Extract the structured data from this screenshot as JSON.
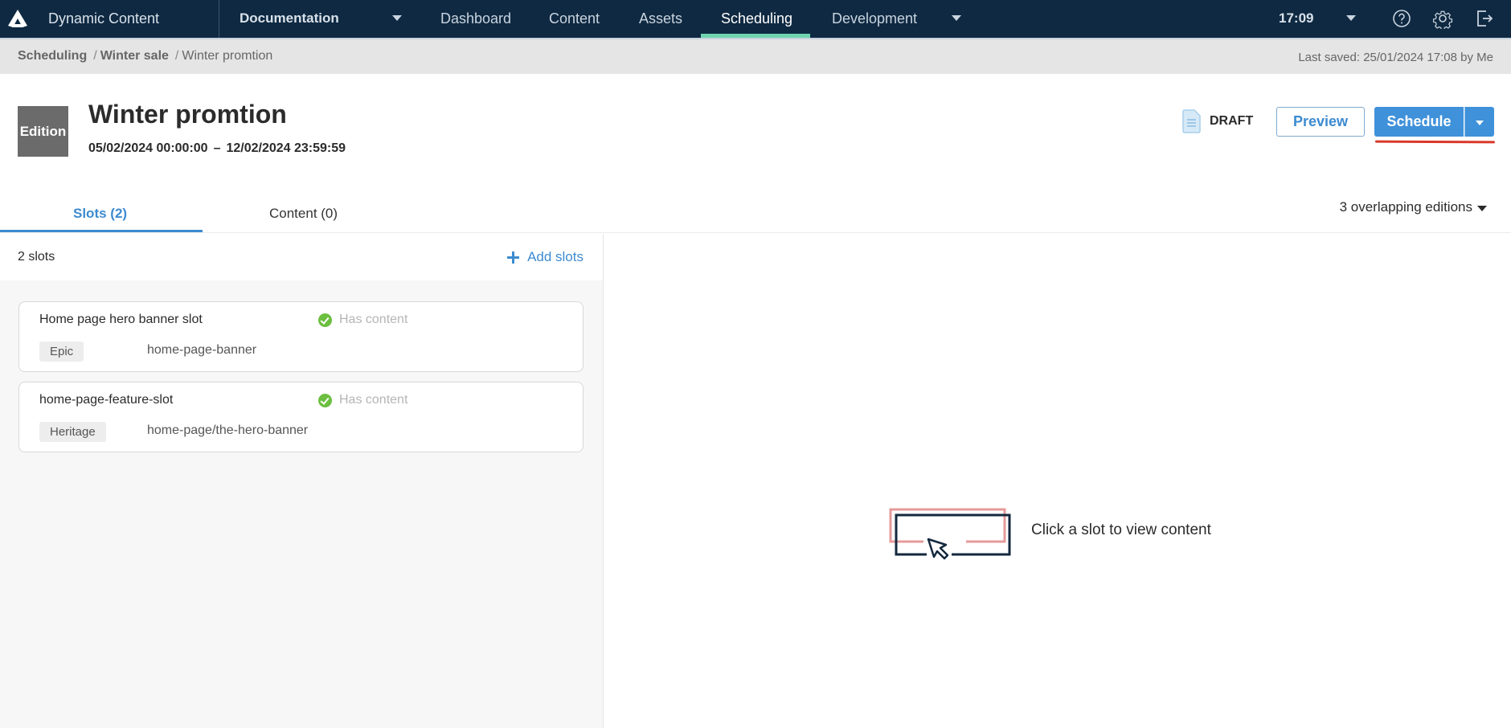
{
  "topnav": {
    "app_name": "Dynamic Content",
    "hub": "Documentation",
    "items": [
      {
        "label": "Dashboard",
        "active": false
      },
      {
        "label": "Content",
        "active": false
      },
      {
        "label": "Assets",
        "active": false
      },
      {
        "label": "Scheduling",
        "active": true
      },
      {
        "label": "Development",
        "active": false
      }
    ],
    "time": "17:09",
    "icons": [
      "help-icon",
      "settings-gear-icon",
      "logout-icon"
    ],
    "active_color": "#6ed4b0",
    "bg_color": "#0f2942"
  },
  "breadcrumb": {
    "items": [
      "Scheduling",
      "Winter sale",
      "Winter promtion"
    ],
    "last_saved": "Last saved: 25/01/2024 17:08 by Me"
  },
  "header": {
    "badge": "Edition",
    "title": "Winter promtion",
    "start": "05/02/2024 00:00:00",
    "separator": "–",
    "end": "12/02/2024 23:59:59",
    "status": "DRAFT",
    "preview_label": "Preview",
    "schedule_label": "Schedule",
    "accent_color": "#3f91da"
  },
  "tabs": {
    "items": [
      {
        "label": "Slots (2)",
        "active": true
      },
      {
        "label": "Content (0)",
        "active": false
      }
    ],
    "overlap": "3 overlapping editions"
  },
  "slots": {
    "count": "2 slots",
    "add_label": "Add slots",
    "items": [
      {
        "name": "Home page hero banner slot",
        "status": "Has content",
        "tag": "Epic",
        "key": "home-page-banner"
      },
      {
        "name": "home-page-feature-slot",
        "status": "Has content",
        "tag": "Heritage",
        "key": "home-page/the-hero-banner"
      }
    ]
  },
  "empty_state": {
    "message": "Click a slot to view content"
  }
}
